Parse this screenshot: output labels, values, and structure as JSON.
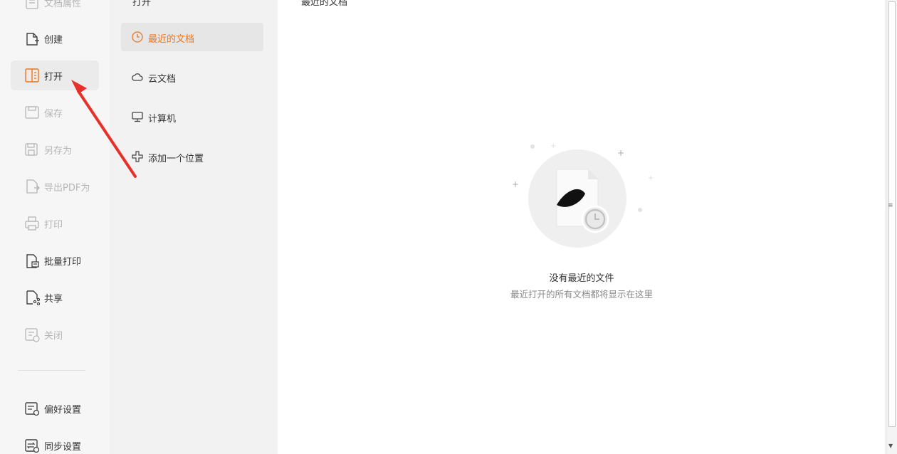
{
  "nav": {
    "top_partial_label": "文档属性",
    "items": [
      {
        "label": "创建",
        "icon": "create-file-icon",
        "state": "normal"
      },
      {
        "label": "打开",
        "icon": "open-folder-icon",
        "state": "active"
      },
      {
        "label": "保存",
        "icon": "save-icon",
        "state": "disabled"
      },
      {
        "label": "另存为",
        "icon": "save-as-icon",
        "state": "disabled"
      },
      {
        "label": "导出PDF为",
        "icon": "export-pdf-icon",
        "state": "disabled"
      },
      {
        "label": "打印",
        "icon": "print-icon",
        "state": "disabled"
      },
      {
        "label": "批量打印",
        "icon": "batch-print-icon",
        "state": "normal"
      },
      {
        "label": "共享",
        "icon": "share-icon",
        "state": "normal"
      },
      {
        "label": "关闭",
        "icon": "close-doc-icon",
        "state": "disabled"
      }
    ],
    "bottom_items": [
      {
        "label": "偏好设置",
        "icon": "preferences-icon"
      },
      {
        "label": "同步设置",
        "icon": "sync-settings-icon"
      }
    ]
  },
  "middle": {
    "header": "打开",
    "items": [
      {
        "label": "最近的文档",
        "icon": "clock-icon",
        "active": true
      },
      {
        "label": "云文档",
        "icon": "cloud-icon",
        "active": false
      },
      {
        "label": "计算机",
        "icon": "computer-icon",
        "active": false
      },
      {
        "label": "添加一个位置",
        "icon": "add-location-icon",
        "active": false
      }
    ]
  },
  "main": {
    "title": "最近的文档",
    "empty_title": "没有最近的文件",
    "empty_subtitle": "最近打开的所有文档都将显示在这里"
  },
  "colors": {
    "accent": "#e87722",
    "annotation": "#e8302a"
  }
}
